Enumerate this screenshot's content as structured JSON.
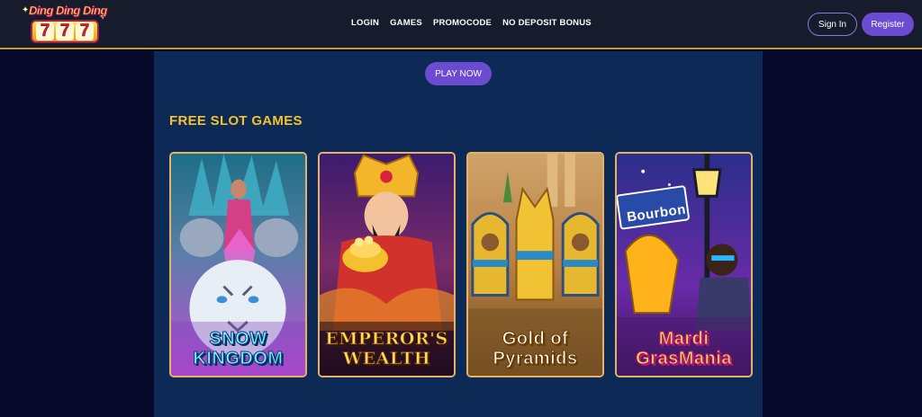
{
  "logo": {
    "top_text": "Ding Ding Ding",
    "reels": [
      "7",
      "7",
      "7"
    ]
  },
  "nav": [
    "LOGIN",
    "GAMES",
    "PROMOCODE",
    "NO DEPOSIT BONUS"
  ],
  "header": {
    "signin_label": "Sign In",
    "register_label": "Register"
  },
  "main": {
    "play_label": "PLAY NOW",
    "section_title": "FREE SLOT GAMES",
    "games": [
      {
        "line1": "SNOW",
        "line2": "KINGDOM"
      },
      {
        "line1": "EMPEROR'S",
        "line2": "WEALTH"
      },
      {
        "line1": "Gold of",
        "line2": "Pyramids"
      },
      {
        "line1": "Mardi",
        "line2": "GrasMania",
        "sign": "Bourbon"
      }
    ]
  },
  "colors": {
    "page_bg": "#07092a",
    "header_bg": "#161c2c",
    "main_bg": "#0c2a55",
    "accent": "#6c4bd3",
    "title": "#f6c12d",
    "header_border": "#c69a2a"
  },
  "icons": [
    "logo-image"
  ]
}
